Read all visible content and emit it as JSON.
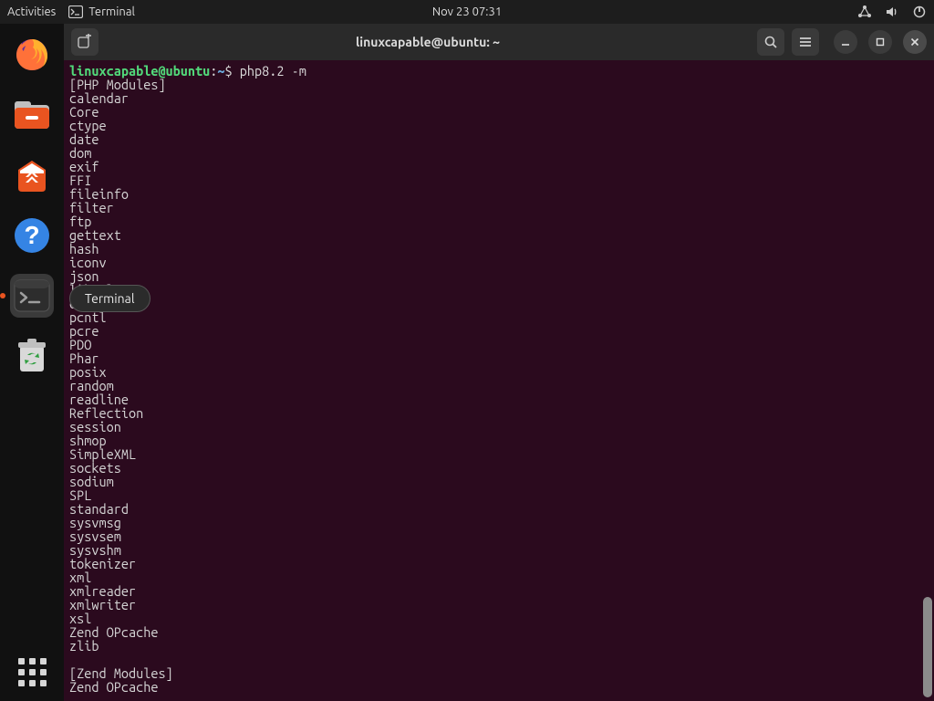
{
  "topbar": {
    "activities": "Activities",
    "app_label": "Terminal",
    "clock": "Nov 23  07:31"
  },
  "dock": {
    "tooltip": "Terminal"
  },
  "titlebar": {
    "title": "linuxcapable@ubuntu: ~"
  },
  "prompt": {
    "user_host": "linuxcapable@ubuntu",
    "colon": ":",
    "path": "~",
    "dollar": "$",
    "command": "php8.2 -m"
  },
  "output_lines": [
    "[PHP Modules]",
    "calendar",
    "Core",
    "ctype",
    "date",
    "dom",
    "exif",
    "FFI",
    "fileinfo",
    "filter",
    "ftp",
    "gettext",
    "hash",
    "iconv",
    "json",
    "libxml",
    "openssl",
    "pcntl",
    "pcre",
    "PDO",
    "Phar",
    "posix",
    "random",
    "readline",
    "Reflection",
    "session",
    "shmop",
    "SimpleXML",
    "sockets",
    "sodium",
    "SPL",
    "standard",
    "sysvmsg",
    "sysvsem",
    "sysvshm",
    "tokenizer",
    "xml",
    "xmlreader",
    "xmlwriter",
    "xsl",
    "Zend OPcache",
    "zlib",
    "",
    "[Zend Modules]",
    "Zend OPcache"
  ]
}
